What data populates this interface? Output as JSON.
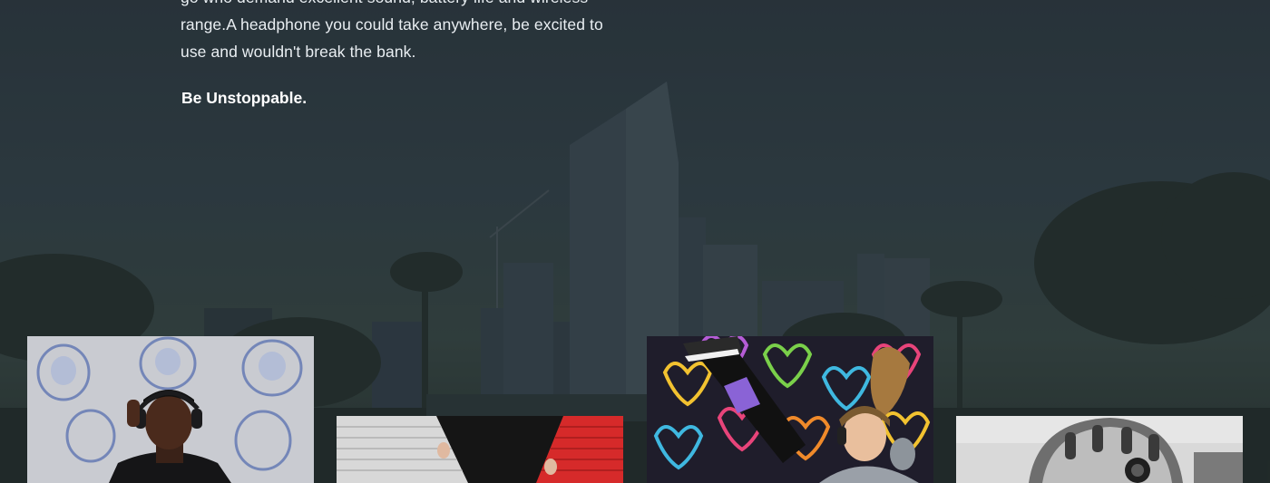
{
  "hero": {
    "body_text_lines": [
      "go who demand excellent sound, battery life and wireless",
      "range.A headphone you could take anywhere, be excited to",
      "use and wouldn't break the bank."
    ],
    "tagline": "Be Unstoppable."
  },
  "gallery": {
    "items": [
      {
        "image": "man-wearing-headphones-buddha-mural"
      },
      {
        "image": "arm-raised-brick-wall-red-white"
      },
      {
        "image": "woman-dancing-heart-graffiti-wall"
      },
      {
        "image": "helmet-and-headphones-black-and-white"
      }
    ]
  }
}
